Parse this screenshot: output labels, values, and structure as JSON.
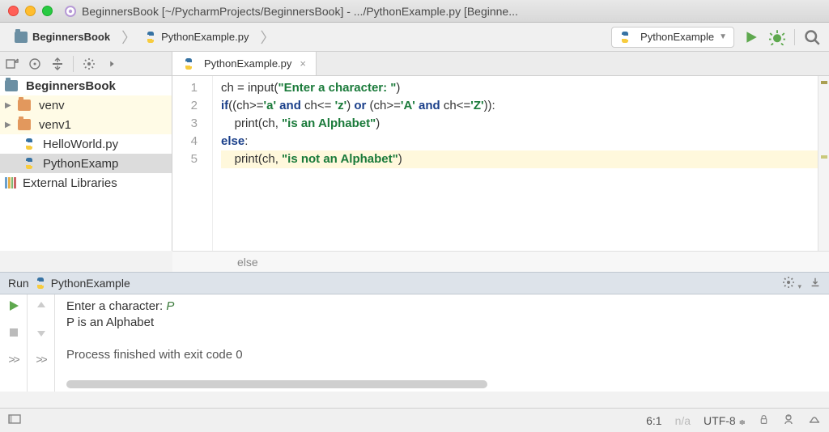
{
  "window": {
    "title": "BeginnersBook [~/PycharmProjects/BeginnersBook] - .../PythonExample.py [Beginne..."
  },
  "breadcrumb": {
    "project": "BeginnersBook",
    "file": "PythonExample.py"
  },
  "run_config": {
    "name": "PythonExample"
  },
  "editor_tab": {
    "name": "PythonExample.py"
  },
  "project_tree": {
    "root": "BeginnersBook",
    "items": [
      {
        "name": "venv"
      },
      {
        "name": "venv1"
      },
      {
        "name": "HelloWorld.py"
      },
      {
        "name": "PythonExamp"
      }
    ],
    "ext_lib": "External Libraries"
  },
  "code": {
    "lines": [
      "1",
      "2",
      "3",
      "4",
      "5"
    ],
    "l1": {
      "a": "ch = ",
      "b": "input",
      "c": "(",
      "d": "\"Enter a character: \"",
      "e": ")"
    },
    "l2": {
      "a": "if",
      "b": "((ch>=",
      "c": "'a'",
      "d": " and ",
      "e": "ch<= ",
      "f": "'z'",
      "g": ") ",
      "h": "or",
      "i": " (ch>=",
      "j": "'A'",
      "k": " and ",
      "l": "ch<=",
      "m": "'Z'",
      "n": ")):"
    },
    "l3": {
      "a": "    ",
      "b": "print",
      "c": "(ch, ",
      "d": "\"is an Alphabet\"",
      "e": ")"
    },
    "l4": {
      "a": "else",
      "b": ":"
    },
    "l5": {
      "a": "    ",
      "b": "print",
      "c": "(ch, ",
      "d": "\"is not an Alphabet\"",
      "e": ")"
    },
    "context": "else"
  },
  "run_panel": {
    "label_run": "Run",
    "title": "PythonExample",
    "console": {
      "prompt": "Enter a character: ",
      "input": "P",
      "out1": "P is an Alphabet",
      "out2": "Process finished with exit code 0"
    }
  },
  "status": {
    "pos": "6:1",
    "na": "n/a",
    "enc": "UTF-8"
  }
}
